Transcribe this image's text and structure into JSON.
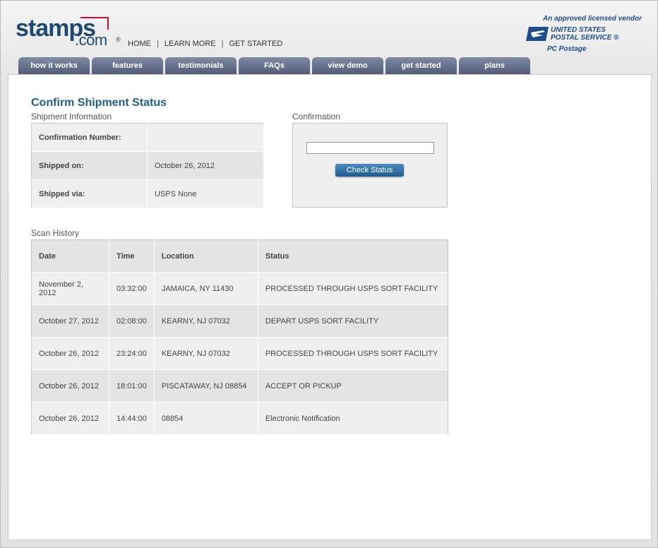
{
  "brand": {
    "logo_word": "stamps",
    "logo_dotcom": ".com",
    "logo_reg": "®"
  },
  "topnav": {
    "home": "HOME",
    "learn_more": "LEARN MORE",
    "get_started": "GET STARTED",
    "separator": "|"
  },
  "usps": {
    "vendor_text": "An approved licensed vendor",
    "line1": "UNITED STATES",
    "line2": "POSTAL SERVICE ®",
    "pc_postage": "PC Postage"
  },
  "tabs": [
    "how it works",
    "features",
    "testimonials",
    "FAQs",
    "view demo",
    "get started",
    "plans"
  ],
  "page": {
    "title": "Confirm Shipment Status"
  },
  "shipment_info": {
    "label": "Shipment Information",
    "rows": [
      {
        "key": "Confirmation Number:",
        "value": ""
      },
      {
        "key": "Shipped on:",
        "value": "October 26, 2012"
      },
      {
        "key": "Shipped via:",
        "value": "USPS None"
      }
    ]
  },
  "confirmation": {
    "label": "Confirmation",
    "input_value": "",
    "button_label": "Check Status"
  },
  "scan_history": {
    "label": "Scan History",
    "columns": [
      "Date",
      "Time",
      "Location",
      "Status"
    ],
    "rows": [
      [
        "November 2, 2012",
        "03:32:00",
        "JAMAICA, NY 11430",
        "PROCESSED THROUGH USPS SORT FACILITY"
      ],
      [
        "October 27, 2012",
        "02:08:00",
        "KEARNY, NJ 07032",
        "DEPART USPS SORT FACILITY"
      ],
      [
        "October 26, 2012",
        "23:24:00",
        "KEARNY, NJ 07032",
        "PROCESSED THROUGH USPS SORT FACILITY"
      ],
      [
        "October 26, 2012",
        "18:01:00",
        "PISCATAWAY, NJ 08854",
        "ACCEPT OR PICKUP"
      ],
      [
        "October 26, 2012",
        "14:44:00",
        "08854",
        "Electronic Notification"
      ]
    ]
  },
  "colors": {
    "brand_blue": "#1d4a72",
    "brand_red": "#c8102e",
    "tab_bg": "#5e6984",
    "title_blue": "#1f5e8a",
    "usps_blue": "#1e4b8c"
  }
}
